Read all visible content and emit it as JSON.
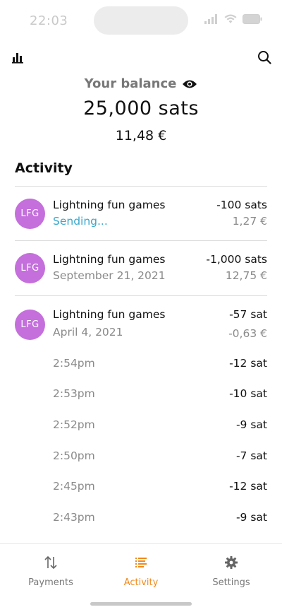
{
  "status_bar": {
    "time": "22:03"
  },
  "balance": {
    "label": "Your balance",
    "sats": "25,000 sats",
    "fiat": "11,48 €"
  },
  "activity": {
    "title": "Activity",
    "transactions": [
      {
        "avatar": "LFG",
        "name": "Lightning fun games",
        "sub": "Sending...",
        "amount": "-100 sats",
        "fiat": "1,27 €"
      },
      {
        "avatar": "LFG",
        "name": "Lightning fun games",
        "sub": "September 21, 2021",
        "amount": "-1,000 sats",
        "fiat": "12,75 €"
      },
      {
        "avatar": "LFG",
        "name": "Lightning fun games",
        "sub": "April 4, 2021",
        "amount": "-57 sat",
        "fiat": "-0,63 €",
        "sub_items": [
          {
            "time": "2:54pm",
            "amount": "-12 sat"
          },
          {
            "time": "2:53pm",
            "amount": "-10 sat"
          },
          {
            "time": "2:52pm",
            "amount": "-9 sat"
          },
          {
            "time": "2:50pm",
            "amount": "-7 sat"
          },
          {
            "time": "2:45pm",
            "amount": "-12 sat"
          },
          {
            "time": "2:43pm",
            "amount": "-9 sat"
          }
        ]
      }
    ]
  },
  "tabs": [
    {
      "label": "Payments",
      "icon": "arrows-updown-icon",
      "active": false
    },
    {
      "label": "Activity",
      "icon": "list-icon",
      "active": true
    },
    {
      "label": "Settings",
      "icon": "gear-icon",
      "active": false
    }
  ],
  "colors": {
    "accent": "#f08a1c",
    "avatar": "#c46fdc",
    "sending": "#3aa7cc"
  }
}
